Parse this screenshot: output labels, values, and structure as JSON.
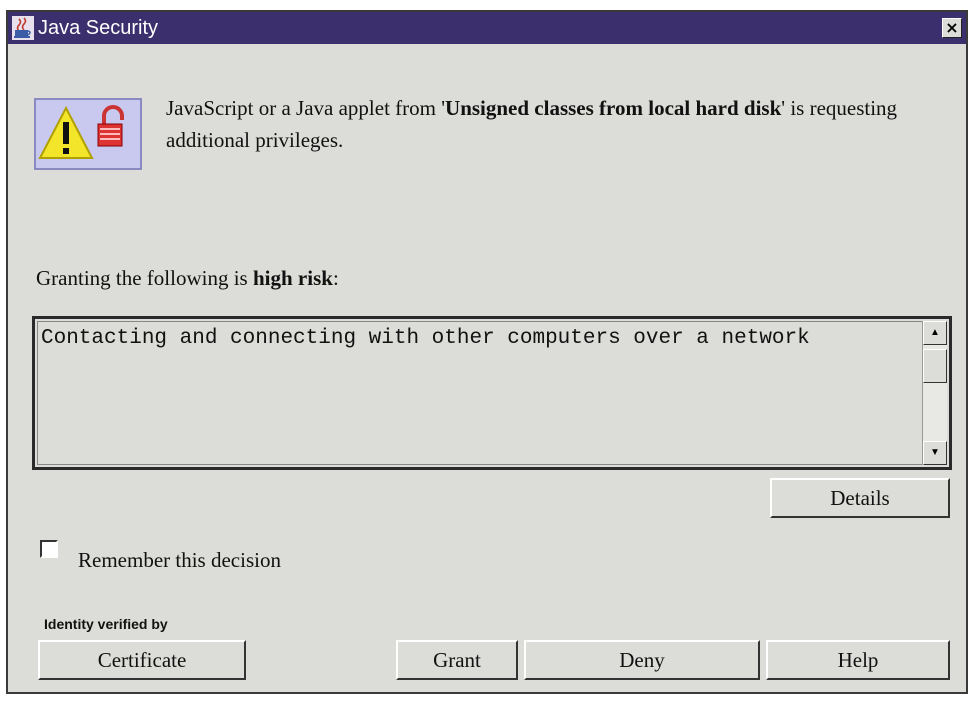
{
  "window": {
    "title": "Java Security",
    "close_label": "×"
  },
  "message": {
    "prefix": "JavaScript or a Java applet from '",
    "source": "Unsigned classes from local hard disk",
    "suffix": "' is requesting additional privileges."
  },
  "risk": {
    "prefix": "Granting the following is ",
    "level": "high risk",
    "suffix": ":"
  },
  "permissions": [
    "Contacting and connecting with other computers over a network"
  ],
  "buttons": {
    "details": "Details",
    "certificate": "Certificate",
    "grant": "Grant",
    "deny": "Deny",
    "help": "Help"
  },
  "remember": {
    "label": "Remember this decision",
    "checked": false
  },
  "identity_label": "Identity verified by",
  "icons": {
    "app": "java-cup-icon",
    "warning": "warning-lock-icon"
  },
  "colors": {
    "titlebar": "#3c2f6e",
    "dialog_bg": "#dcdcd8"
  }
}
